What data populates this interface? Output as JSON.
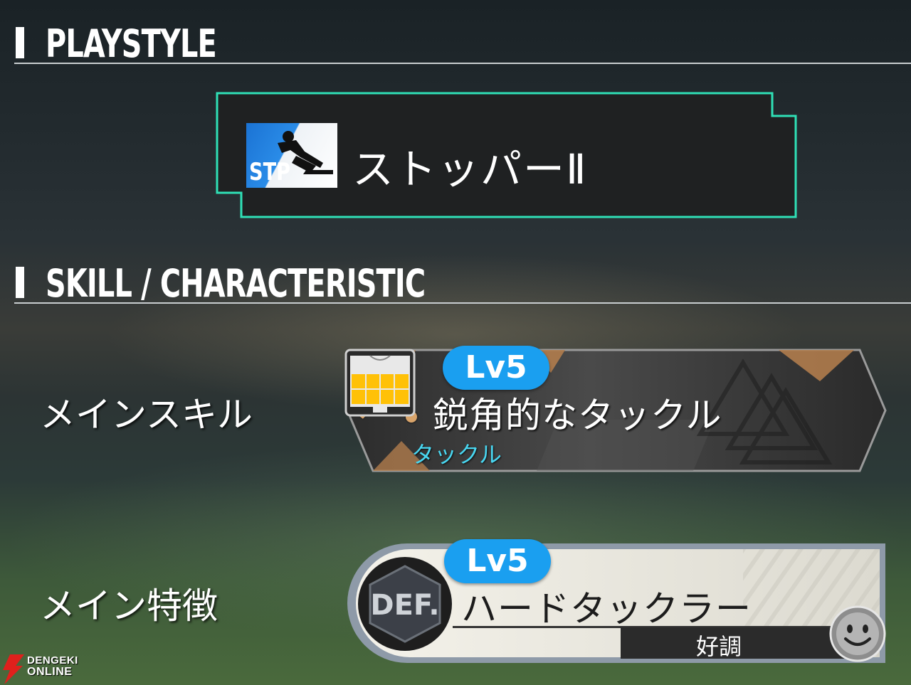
{
  "playstyle": {
    "section_title": "PLAYSTYLE",
    "icon_label": "STP",
    "name": "ストッパーⅡ",
    "frame_color": "#2fe0b6"
  },
  "skill_section": {
    "section_title": "SKILL / CHARACTERISTIC"
  },
  "main_skill": {
    "label": "メインスキル",
    "level": "Lv5",
    "name": "鋭角的なタックル",
    "category": "タックル",
    "icon": "tackle-players-icon",
    "position_icon": "pitch-position-icon"
  },
  "main_trait": {
    "label": "メイン特徴",
    "level": "Lv5",
    "badge": "DEF.",
    "name": "ハードタックラー",
    "condition": "好調",
    "condition_icon": "smiley-face-icon"
  },
  "watermark": {
    "line1": "DENGEKI",
    "line2": "ONLINE"
  },
  "colors": {
    "accent": "#2fe0b6",
    "level_pill": "#1a9ff0",
    "category_text": "#49d6f0",
    "pitch_fill": "#ffc107"
  }
}
